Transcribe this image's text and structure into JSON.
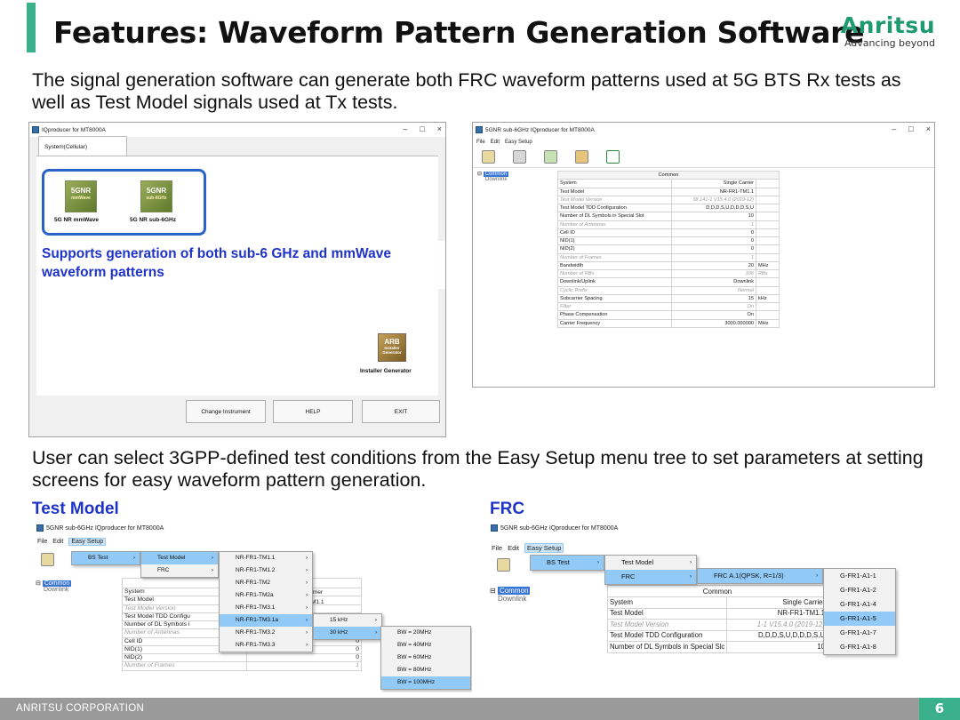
{
  "slide": {
    "title": "Features: Waveform Pattern Generation Software",
    "intro": "The signal generation software can generate both FRC waveform patterns used at 5G BTS Rx tests as well as Test Model signals used at Tx tests.",
    "intro2": "User can select 3GPP-defined test conditions from the Easy Setup menu tree to set parameters at setting screens for easy waveform pattern generation.",
    "callout": "Supports generation of both sub-6 GHz and mmWave waveform patterns",
    "test_model_heading": "Test Model",
    "frc_heading": "FRC",
    "page_number": "6",
    "company": "ANRITSU CORPORATION",
    "accent_color": "#3bb18b",
    "highlight_color": "#1f33c9"
  },
  "logo": {
    "name": "Anritsu",
    "tagline": "Advancing beyond"
  },
  "launcher": {
    "title": "IQproducer for MT8000A",
    "tab": "System(Cellular)",
    "apps": [
      {
        "name": "5G NR mmWave",
        "tile_top": "5GNR",
        "tile_bottom": "mmWave"
      },
      {
        "name": "5G NR sub-6GHz",
        "tile_top": "5GNR",
        "tile_bottom": "sub-6GHz"
      }
    ],
    "installer": {
      "name": "Installer Generator",
      "tile": "ARB"
    },
    "buttons": [
      "Change Instrument",
      "HELP",
      "EXIT"
    ]
  },
  "param_window": {
    "title": "5GNR sub-6GHz IQproducer for MT8000A",
    "menu": [
      "File",
      "Edit",
      "Easy Setup"
    ],
    "tree": {
      "root": "Common",
      "child": "Downlink"
    },
    "header": "Common",
    "rows": [
      {
        "name": "System",
        "value": "Single Carrier",
        "unit": "",
        "dim": false
      },
      {
        "name": "Test Model",
        "value": "NR-FR1-TM1.1",
        "unit": "",
        "dim": false
      },
      {
        "name": "Test Model Version",
        "value": "38.141-1 V15.4.0 (2019-12)",
        "unit": "",
        "dim": true
      },
      {
        "name": "Test Model TDD Configuration",
        "value": "D,D,D,S,U,D,D,D,S,U",
        "unit": "",
        "dim": false
      },
      {
        "name": "Number of DL Symbols in Special Slot",
        "value": "10",
        "unit": "",
        "dim": false
      },
      {
        "name": "Number of Antennas",
        "value": "1",
        "unit": "",
        "dim": true
      },
      {
        "name": "Cell ID",
        "value": "0",
        "unit": "",
        "dim": false
      },
      {
        "name": "NID(1)",
        "value": "0",
        "unit": "",
        "dim": false
      },
      {
        "name": "NID(2)",
        "value": "0",
        "unit": "",
        "dim": false
      },
      {
        "name": "Number of Frames",
        "value": "1",
        "unit": "",
        "dim": true
      },
      {
        "name": "Bandwidth",
        "value": "20",
        "unit": "MHz",
        "dim": false
      },
      {
        "name": "Number of RBs",
        "value": "106",
        "unit": "RBs",
        "dim": true
      },
      {
        "name": "Downlink/Uplink",
        "value": "Downlink",
        "unit": "",
        "dim": false
      },
      {
        "name": "Cyclic Prefix",
        "value": "Normal",
        "unit": "",
        "dim": true
      },
      {
        "name": "Subcarrier Spacing",
        "value": "15",
        "unit": "kHz",
        "dim": false
      },
      {
        "name": "Filter",
        "value": "On",
        "unit": "",
        "dim": true
      },
      {
        "name": "Phase Compensation",
        "value": "On",
        "unit": "",
        "dim": false
      },
      {
        "name": "Carrier Frequency",
        "value": "3000.000000",
        "unit": "MHz",
        "dim": false
      }
    ]
  },
  "tm_window": {
    "title": "5GNR sub-6GHz IQproducer for MT8000A",
    "menu": [
      "File",
      "Edit",
      "Easy Setup"
    ],
    "menu1": [
      {
        "label": "BS Test"
      }
    ],
    "menu2": [
      {
        "label": "Test Model"
      },
      {
        "label": "FRC"
      }
    ],
    "menu3": [
      "NR-FR1-TM1.1",
      "NR-FR1-TM1.2",
      "NR-FR1-TM2",
      "NR-FR1-TM2a",
      "NR-FR1-TM3.1",
      "NR-FR1-TM3.1a",
      "NR-FR1-TM3.2",
      "NR-FR1-TM3.3"
    ],
    "menu4": [
      "15 kHz",
      "30 kHz"
    ],
    "menu5": [
      "BW = 20MHz",
      "BW = 40MHz",
      "BW = 60MHz",
      "BW = 80MHz",
      "BW = 100MHz"
    ],
    "behind": {
      "header": "Common",
      "peek1": "arrier",
      "peek2": "M1.1"
    },
    "rows": [
      {
        "name": "System",
        "value": "",
        "dim": false
      },
      {
        "name": "Test Model",
        "value": "",
        "dim": false
      },
      {
        "name": "Test Model Version",
        "value": "",
        "dim": true
      },
      {
        "name": "Test Model TDD Configu",
        "value": "",
        "dim": false
      },
      {
        "name": "Number of DL Symbols i",
        "value": "",
        "dim": false
      },
      {
        "name": "Number of Antennas",
        "value": "1",
        "dim": true
      },
      {
        "name": "Cell ID",
        "value": "0",
        "dim": false
      },
      {
        "name": "NID(1)",
        "value": "0",
        "dim": false
      },
      {
        "name": "NID(2)",
        "value": "0",
        "dim": false
      },
      {
        "name": "Number of Frames",
        "value": "1",
        "dim": true
      }
    ]
  },
  "frc_window": {
    "title": "5GNR sub-6GHz IQproducer for MT8000A",
    "menu": [
      "File",
      "Edit",
      "Easy Setup"
    ],
    "menu1": [
      "BS Test"
    ],
    "menu2": [
      "Test Model",
      "FRC"
    ],
    "menu3": [
      "FRC A.1(QPSK, R=1/3)"
    ],
    "menu4": [
      "G-FR1-A1-1",
      "G-FR1-A1-2",
      "G-FR1-A1-4",
      "G-FR1-A1-5",
      "G-FR1-A1-7",
      "G-FR1-A1-8"
    ],
    "header": "Common",
    "rows": [
      {
        "name": "System",
        "value": "Single Carrier",
        "dim": false
      },
      {
        "name": "Test Model",
        "value": "NR-FR1-TM1.1",
        "dim": false
      },
      {
        "name": "Test Model Version",
        "value": "1-1 V15.4.0 (2019-12)",
        "dim": true
      },
      {
        "name": "Test Model TDD Configuration",
        "value": "D,D,D,S,U,D,D,D,S,U",
        "dim": false
      },
      {
        "name": "Number of DL Symbols in Special Slc",
        "value": "10",
        "dim": false
      }
    ]
  }
}
